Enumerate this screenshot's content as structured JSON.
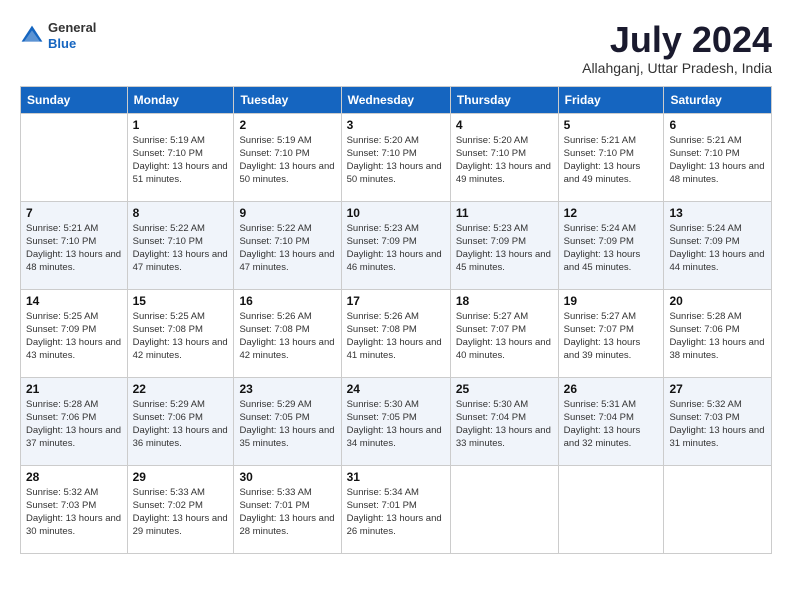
{
  "logo": {
    "line1": "General",
    "line2": "Blue"
  },
  "title": "July 2024",
  "location": "Allahganj, Uttar Pradesh, India",
  "days_of_week": [
    "Sunday",
    "Monday",
    "Tuesday",
    "Wednesday",
    "Thursday",
    "Friday",
    "Saturday"
  ],
  "weeks": [
    [
      {
        "day": "",
        "sunrise": "",
        "sunset": "",
        "daylight": ""
      },
      {
        "day": "1",
        "sunrise": "Sunrise: 5:19 AM",
        "sunset": "Sunset: 7:10 PM",
        "daylight": "Daylight: 13 hours and 51 minutes."
      },
      {
        "day": "2",
        "sunrise": "Sunrise: 5:19 AM",
        "sunset": "Sunset: 7:10 PM",
        "daylight": "Daylight: 13 hours and 50 minutes."
      },
      {
        "day": "3",
        "sunrise": "Sunrise: 5:20 AM",
        "sunset": "Sunset: 7:10 PM",
        "daylight": "Daylight: 13 hours and 50 minutes."
      },
      {
        "day": "4",
        "sunrise": "Sunrise: 5:20 AM",
        "sunset": "Sunset: 7:10 PM",
        "daylight": "Daylight: 13 hours and 49 minutes."
      },
      {
        "day": "5",
        "sunrise": "Sunrise: 5:21 AM",
        "sunset": "Sunset: 7:10 PM",
        "daylight": "Daylight: 13 hours and 49 minutes."
      },
      {
        "day": "6",
        "sunrise": "Sunrise: 5:21 AM",
        "sunset": "Sunset: 7:10 PM",
        "daylight": "Daylight: 13 hours and 48 minutes."
      }
    ],
    [
      {
        "day": "7",
        "sunrise": "Sunrise: 5:21 AM",
        "sunset": "Sunset: 7:10 PM",
        "daylight": "Daylight: 13 hours and 48 minutes."
      },
      {
        "day": "8",
        "sunrise": "Sunrise: 5:22 AM",
        "sunset": "Sunset: 7:10 PM",
        "daylight": "Daylight: 13 hours and 47 minutes."
      },
      {
        "day": "9",
        "sunrise": "Sunrise: 5:22 AM",
        "sunset": "Sunset: 7:10 PM",
        "daylight": "Daylight: 13 hours and 47 minutes."
      },
      {
        "day": "10",
        "sunrise": "Sunrise: 5:23 AM",
        "sunset": "Sunset: 7:09 PM",
        "daylight": "Daylight: 13 hours and 46 minutes."
      },
      {
        "day": "11",
        "sunrise": "Sunrise: 5:23 AM",
        "sunset": "Sunset: 7:09 PM",
        "daylight": "Daylight: 13 hours and 45 minutes."
      },
      {
        "day": "12",
        "sunrise": "Sunrise: 5:24 AM",
        "sunset": "Sunset: 7:09 PM",
        "daylight": "Daylight: 13 hours and 45 minutes."
      },
      {
        "day": "13",
        "sunrise": "Sunrise: 5:24 AM",
        "sunset": "Sunset: 7:09 PM",
        "daylight": "Daylight: 13 hours and 44 minutes."
      }
    ],
    [
      {
        "day": "14",
        "sunrise": "Sunrise: 5:25 AM",
        "sunset": "Sunset: 7:09 PM",
        "daylight": "Daylight: 13 hours and 43 minutes."
      },
      {
        "day": "15",
        "sunrise": "Sunrise: 5:25 AM",
        "sunset": "Sunset: 7:08 PM",
        "daylight": "Daylight: 13 hours and 42 minutes."
      },
      {
        "day": "16",
        "sunrise": "Sunrise: 5:26 AM",
        "sunset": "Sunset: 7:08 PM",
        "daylight": "Daylight: 13 hours and 42 minutes."
      },
      {
        "day": "17",
        "sunrise": "Sunrise: 5:26 AM",
        "sunset": "Sunset: 7:08 PM",
        "daylight": "Daylight: 13 hours and 41 minutes."
      },
      {
        "day": "18",
        "sunrise": "Sunrise: 5:27 AM",
        "sunset": "Sunset: 7:07 PM",
        "daylight": "Daylight: 13 hours and 40 minutes."
      },
      {
        "day": "19",
        "sunrise": "Sunrise: 5:27 AM",
        "sunset": "Sunset: 7:07 PM",
        "daylight": "Daylight: 13 hours and 39 minutes."
      },
      {
        "day": "20",
        "sunrise": "Sunrise: 5:28 AM",
        "sunset": "Sunset: 7:06 PM",
        "daylight": "Daylight: 13 hours and 38 minutes."
      }
    ],
    [
      {
        "day": "21",
        "sunrise": "Sunrise: 5:28 AM",
        "sunset": "Sunset: 7:06 PM",
        "daylight": "Daylight: 13 hours and 37 minutes."
      },
      {
        "day": "22",
        "sunrise": "Sunrise: 5:29 AM",
        "sunset": "Sunset: 7:06 PM",
        "daylight": "Daylight: 13 hours and 36 minutes."
      },
      {
        "day": "23",
        "sunrise": "Sunrise: 5:29 AM",
        "sunset": "Sunset: 7:05 PM",
        "daylight": "Daylight: 13 hours and 35 minutes."
      },
      {
        "day": "24",
        "sunrise": "Sunrise: 5:30 AM",
        "sunset": "Sunset: 7:05 PM",
        "daylight": "Daylight: 13 hours and 34 minutes."
      },
      {
        "day": "25",
        "sunrise": "Sunrise: 5:30 AM",
        "sunset": "Sunset: 7:04 PM",
        "daylight": "Daylight: 13 hours and 33 minutes."
      },
      {
        "day": "26",
        "sunrise": "Sunrise: 5:31 AM",
        "sunset": "Sunset: 7:04 PM",
        "daylight": "Daylight: 13 hours and 32 minutes."
      },
      {
        "day": "27",
        "sunrise": "Sunrise: 5:32 AM",
        "sunset": "Sunset: 7:03 PM",
        "daylight": "Daylight: 13 hours and 31 minutes."
      }
    ],
    [
      {
        "day": "28",
        "sunrise": "Sunrise: 5:32 AM",
        "sunset": "Sunset: 7:03 PM",
        "daylight": "Daylight: 13 hours and 30 minutes."
      },
      {
        "day": "29",
        "sunrise": "Sunrise: 5:33 AM",
        "sunset": "Sunset: 7:02 PM",
        "daylight": "Daylight: 13 hours and 29 minutes."
      },
      {
        "day": "30",
        "sunrise": "Sunrise: 5:33 AM",
        "sunset": "Sunset: 7:01 PM",
        "daylight": "Daylight: 13 hours and 28 minutes."
      },
      {
        "day": "31",
        "sunrise": "Sunrise: 5:34 AM",
        "sunset": "Sunset: 7:01 PM",
        "daylight": "Daylight: 13 hours and 26 minutes."
      },
      {
        "day": "",
        "sunrise": "",
        "sunset": "",
        "daylight": ""
      },
      {
        "day": "",
        "sunrise": "",
        "sunset": "",
        "daylight": ""
      },
      {
        "day": "",
        "sunrise": "",
        "sunset": "",
        "daylight": ""
      }
    ]
  ]
}
